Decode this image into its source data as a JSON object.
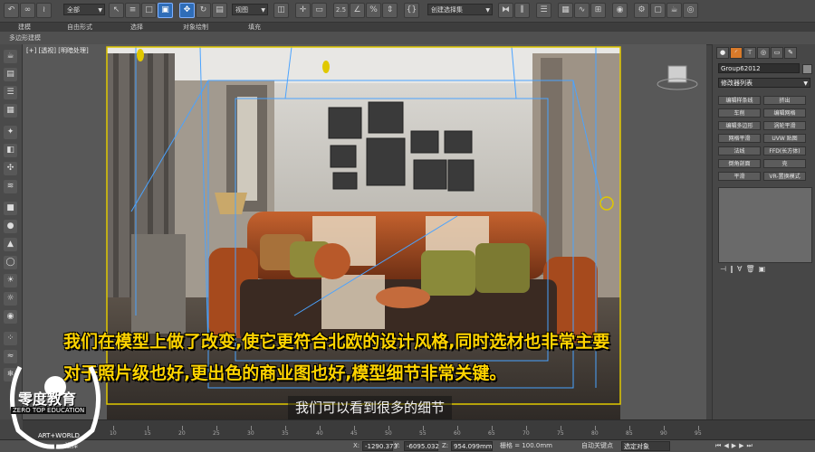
{
  "toolbar": {
    "selection_filter": "全部",
    "reference_coord": "视图",
    "snap_value": "2.5",
    "named_selection": "创建选择集"
  },
  "ribbon": {
    "items": [
      "建模",
      "自由形式",
      "选择",
      "对象绘制",
      "填充"
    ]
  },
  "subbar": {
    "label": "多边形建模"
  },
  "viewport": {
    "label": "[+] [透视] [明暗处理]"
  },
  "command_panel": {
    "object_name": "Group62012",
    "modifier_list": "修改器列表",
    "buttons": [
      "编辑样条线",
      "挤出",
      "车削",
      "编辑网格",
      "编辑多边形",
      "涡轮平滑",
      "网格平滑",
      "UVW 贴图",
      "法线",
      "FFD(长方体)",
      "倒角剖面",
      "壳",
      "平滑",
      "VR-置换模式"
    ]
  },
  "timeline": {
    "ticks": [
      "10",
      "15",
      "20",
      "25",
      "30",
      "35",
      "40",
      "45",
      "50",
      "55",
      "60",
      "65",
      "70",
      "75",
      "80",
      "85",
      "90",
      "95"
    ]
  },
  "status": {
    "x_label": "X:",
    "x_value": "-1290.373",
    "y_label": "Y:",
    "y_value": "-6095.032",
    "z_label": "Z:",
    "z_value": "954.099mm",
    "grid": "栅格 = 100.0mm",
    "auto_key": "自动关键点",
    "selected_object": "选定对象",
    "left_text": "选择"
  },
  "captions": {
    "line1": "我们在模型上做了改变,使它更符合北欧的设计风格,同时选材也非常主要",
    "line2": "对于照片级也好,更出色的商业图也好,模型细节非常关键。",
    "subtitle": "我们可以看到很多的细节"
  },
  "logo": {
    "title": "零度教育",
    "subtitle": "ZERO TOP EDUCATION",
    "brand": "ART+WORLD"
  },
  "colors": {
    "caption": "#ffd400",
    "active_tab": "#d87a2a",
    "selection_box": "#e0c800",
    "frustum": "#4aa3ff"
  }
}
